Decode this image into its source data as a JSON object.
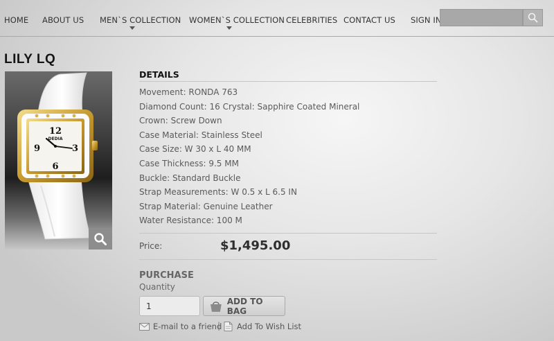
{
  "nav": {
    "items": [
      {
        "label": "HOME"
      },
      {
        "label": "ABOUT US"
      },
      {
        "label": "MEN`S COLLECTION"
      },
      {
        "label": "WOMEN`S COLLECTION"
      },
      {
        "label": "CELEBRITIES"
      },
      {
        "label": "CONTACT US"
      },
      {
        "label": "SIGN IN"
      }
    ],
    "search_placeholder": ""
  },
  "product": {
    "title": "LILY LQ",
    "details_heading": "DETAILS",
    "specs": [
      "Movement: RONDA 763",
      "Diamond Count: 16 Crystal: Sapphire Coated Mineral",
      "Crown: Screw Down",
      "Case Material: Stainless Steel",
      "Case Size: W 30 x L 40 MM",
      "Case Thickness: 9.5 MM",
      "Buckle: Standard Buckle",
      "Strap Measurements: W 0.5 x L 6.5 IN",
      "Strap Material: Genuine Leather",
      "Water Resistance: 100 M"
    ],
    "price_label": "Price:",
    "price": "$1,495.00",
    "image_brand_text": "DEDIA"
  },
  "purchase": {
    "heading": "PURCHASE",
    "quantity_label": "Quantity",
    "quantity_value": "1",
    "add_to_bag_label": "ADD TO BAG",
    "email_friend_label": "E-mail to a friend",
    "separator": "|",
    "wish_list_label": "Add To Wish List"
  },
  "colors": {
    "background": "#e3e3e3",
    "search_field": "#a8a8a8",
    "title": "#151515",
    "price": "#2e2e2e"
  },
  "icons": [
    "search-icon",
    "magnifier-zoom-icon",
    "shopping-bag-icon",
    "envelope-icon",
    "document-icon",
    "caret-down-icon"
  ]
}
